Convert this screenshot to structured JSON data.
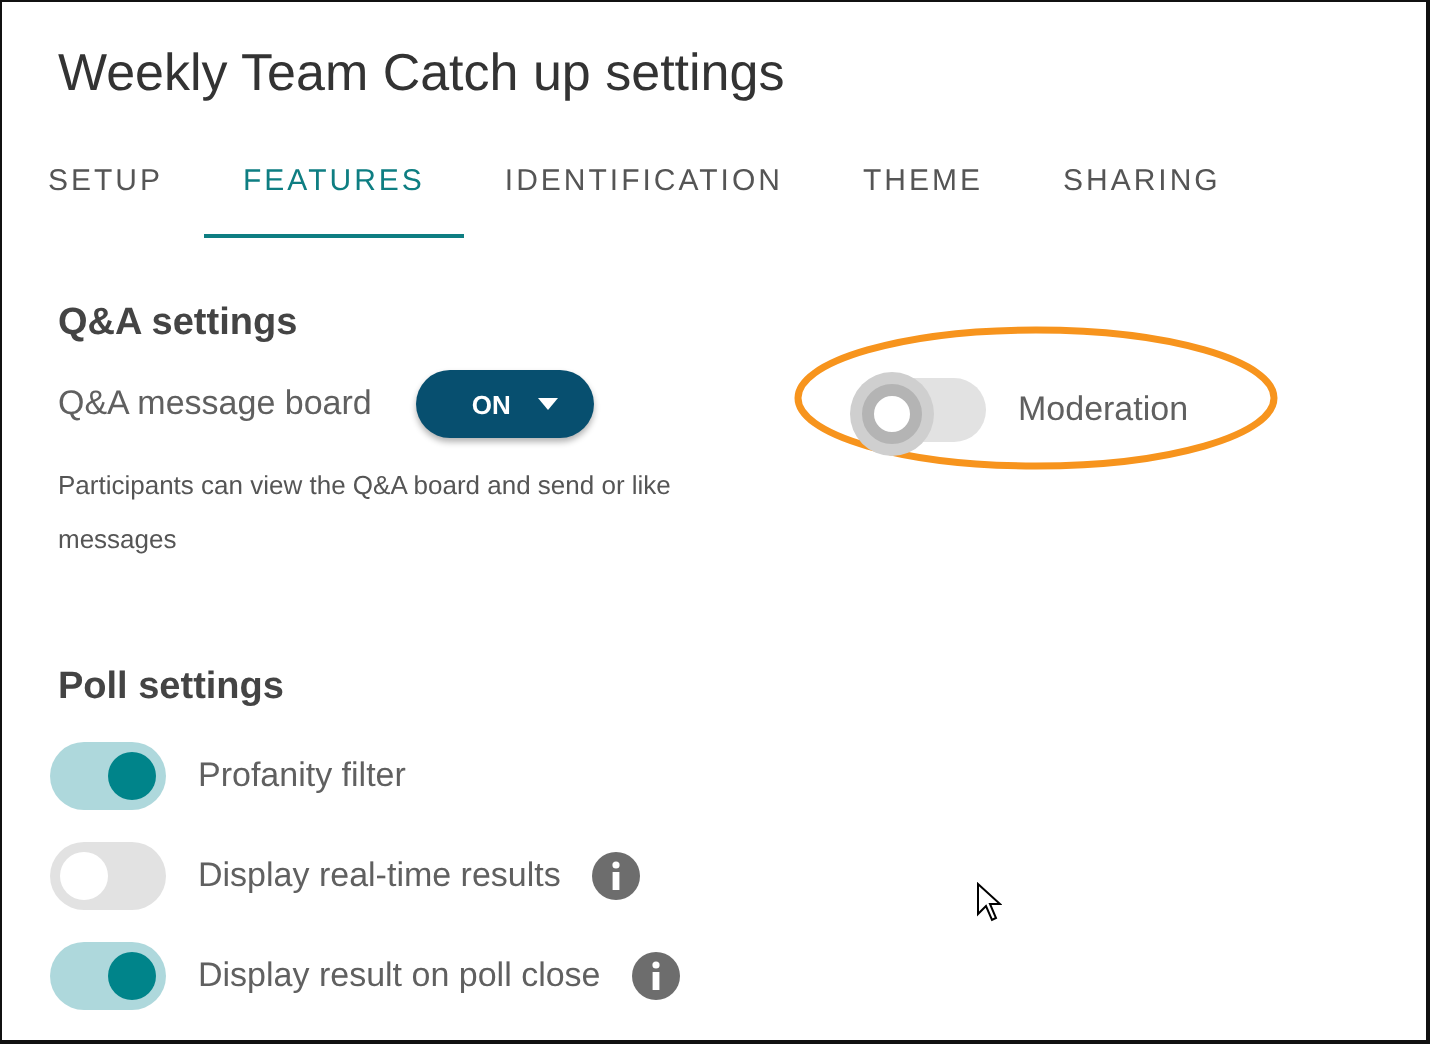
{
  "window": {
    "title": "Weekly Team Catch up settings"
  },
  "tabs": [
    {
      "label": "SETUP",
      "selected": false
    },
    {
      "label": "FEATURES",
      "selected": true
    },
    {
      "label": "IDENTIFICATION",
      "selected": false
    },
    {
      "label": "THEME",
      "selected": false
    },
    {
      "label": "SHARING",
      "selected": false
    }
  ],
  "qa": {
    "heading": "Q&A settings",
    "board_label": "Q&A message board",
    "board_value": "ON",
    "description": "Participants can view the Q&A board and send or like messages",
    "moderation": {
      "label": "Moderation",
      "on": false,
      "highlighted": true
    }
  },
  "poll": {
    "heading": "Poll settings",
    "options": [
      {
        "label": "Profanity filter",
        "on": true,
        "info": false
      },
      {
        "label": "Display real-time results",
        "on": false,
        "info": true
      },
      {
        "label": "Display result on poll close",
        "on": true,
        "info": true
      }
    ]
  }
}
